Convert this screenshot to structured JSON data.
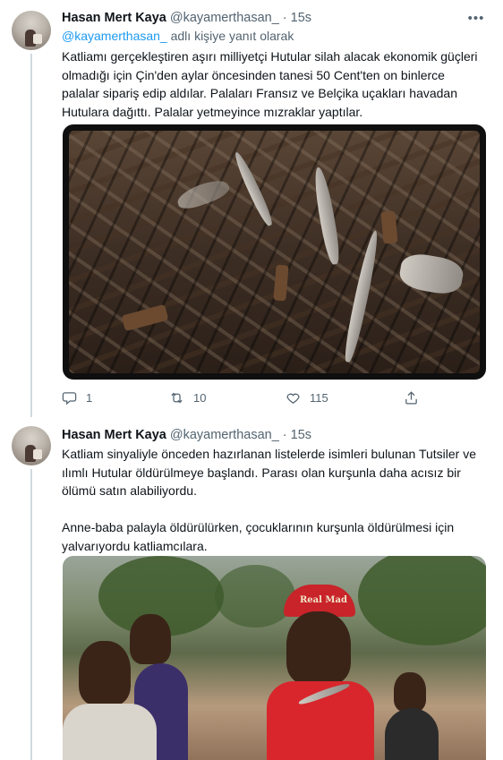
{
  "tweets": [
    {
      "author_name": "Hasan Mert Kaya",
      "handle": "@kayamerthasan_",
      "separator": "·",
      "time": "15s",
      "more_icon": "more-horizontal-icon",
      "reply_mention": "@kayamerthasan_",
      "reply_suffix": "adlı kişiye yanıt olarak",
      "text_lines": [
        "Katliamı gerçekleştiren aşırı milliyetçi Hutular silah alacak ekonomik güçleri",
        "olmadığı için Çin'den aylar öncesinden tanesi 50 Cent'ten on binlerce",
        "palalar sipariş edip aldılar. Palaları Fransız ve Belçika uçakları havadan",
        "Hutulara dağıttı. Palalar yetmeyince mızraklar yaptılar."
      ],
      "media_alt": "pile of machetes",
      "actions": {
        "reply_count": "1",
        "retweet_count": "10",
        "like_count": "115",
        "share_count": ""
      }
    },
    {
      "author_name": "Hasan Mert Kaya",
      "handle": "@kayamerthasan_",
      "separator": "·",
      "time": "15s",
      "more_icon": "more-horizontal-icon",
      "text_lines": [
        "Katliam sinyaliyle önceden hazırlanan listelerde isimleri bulunan Tutsiler ve",
        "ılımlı Hutular öldürülmeye başlandı. Parası olan kurşunla daha acısız bir",
        "ölümü satın alabiliyordu.",
        "",
        "Anne-baba palayla öldürülürken, çocuklarının kurşunla öldürülmesi için",
        "yalvarıyordu katliamcılara."
      ],
      "media_alt": "young men holding a knife",
      "media_caption_text": "Real Mad"
    }
  ],
  "colors": {
    "text": "#0f1419",
    "muted": "#536471",
    "link": "#1d9bf0",
    "thread_line": "#cfd9de"
  }
}
